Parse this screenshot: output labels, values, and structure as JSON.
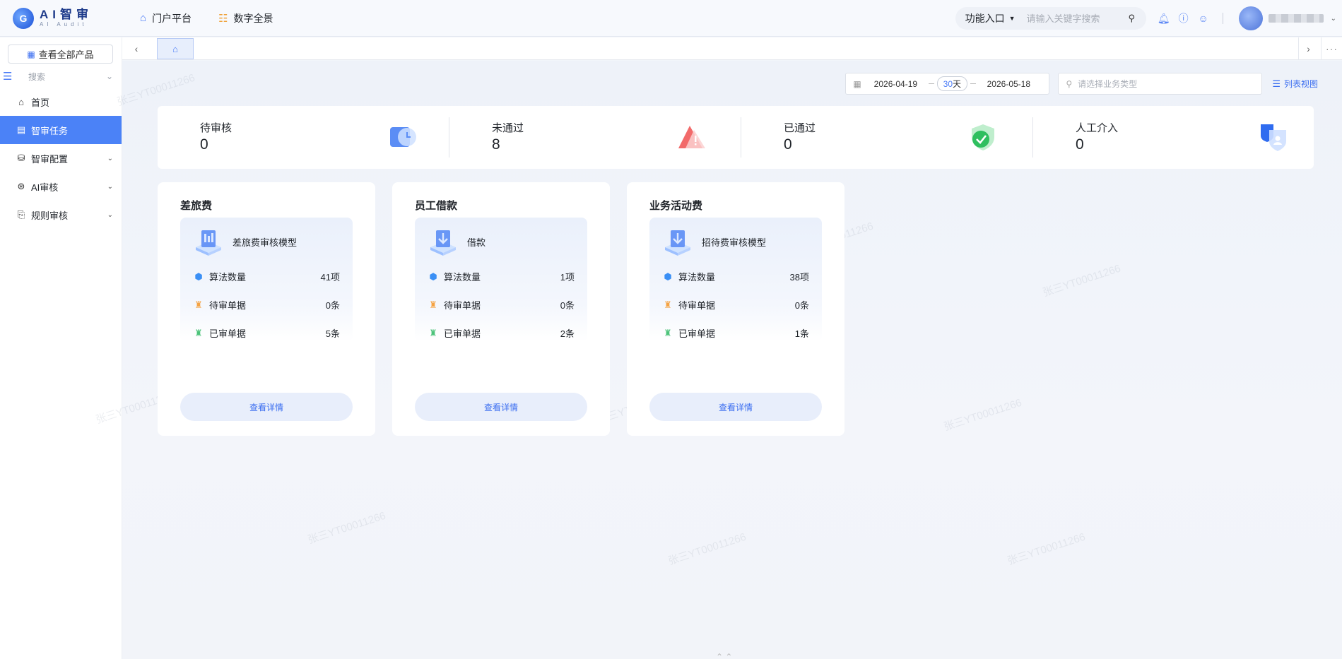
{
  "app": {
    "logo_main": "AI智审",
    "logo_sub": "AI Audit"
  },
  "topnav": [
    {
      "label": "门户平台",
      "icon": "home-icon"
    },
    {
      "label": "数字全景",
      "icon": "database-icon"
    }
  ],
  "header": {
    "func_entry": "功能入口",
    "search_placeholder": "请输入关键字搜索"
  },
  "sidebar": {
    "all_products": "查看全部产品",
    "search_label": "搜索",
    "items": [
      {
        "label": "首页",
        "icon": "home-icon",
        "active": false,
        "expandable": false
      },
      {
        "label": "智审任务",
        "icon": "task-list-icon",
        "active": true,
        "expandable": false
      },
      {
        "label": "智审配置",
        "icon": "config-icon",
        "active": false,
        "expandable": true
      },
      {
        "label": "AI审核",
        "icon": "ai-audit-icon",
        "active": false,
        "expandable": true
      },
      {
        "label": "规则审核",
        "icon": "rule-audit-icon",
        "active": false,
        "expandable": true
      }
    ]
  },
  "filters": {
    "start_date": "2026-04-19",
    "days": "30",
    "days_unit": "天",
    "end_date": "2026-05-18",
    "biz_type_placeholder": "请选择业务类型",
    "list_view": "列表视图"
  },
  "stats": [
    {
      "title": "待审核",
      "value": "0",
      "icon": "clock-icon"
    },
    {
      "title": "未通过",
      "value": "8",
      "icon": "warning-icon"
    },
    {
      "title": "已通过",
      "value": "0",
      "icon": "shield-check-icon"
    },
    {
      "title": "人工介入",
      "value": "0",
      "icon": "user-shield-icon"
    }
  ],
  "cards": [
    {
      "title": "差旅费",
      "model": "差旅费审核模型",
      "metrics": [
        {
          "label": "算法数量",
          "value": "41项"
        },
        {
          "label": "待审单据",
          "value": "0条"
        },
        {
          "label": "已审单据",
          "value": "5条"
        }
      ],
      "button": "查看详情"
    },
    {
      "title": "员工借款",
      "model": "借款",
      "metrics": [
        {
          "label": "算法数量",
          "value": "1项"
        },
        {
          "label": "待审单据",
          "value": "0条"
        },
        {
          "label": "已审单据",
          "value": "2条"
        }
      ],
      "button": "查看详情"
    },
    {
      "title": "业务活动费",
      "model": "招待费审核模型",
      "metrics": [
        {
          "label": "算法数量",
          "value": "38项"
        },
        {
          "label": "待审单据",
          "value": "0条"
        },
        {
          "label": "已审单据",
          "value": "1条"
        }
      ],
      "button": "查看详情"
    }
  ],
  "watermark": "张三YT00011266",
  "colors": {
    "accent": "#4b82f7",
    "link": "#3a6df0"
  }
}
